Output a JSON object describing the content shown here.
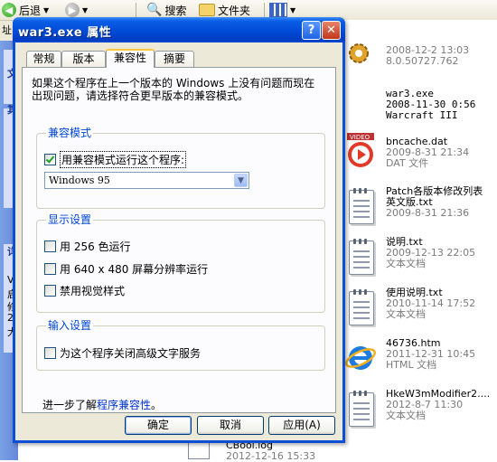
{
  "explorer": {
    "toolbar": {
      "back_label": "后退",
      "search_label": "搜索",
      "folders_label": "文件夹"
    },
    "address_label": "址",
    "left_pane_fragments": [
      "文",
      "其",
      "详",
      "V",
      "启",
      "修",
      "20",
      "大"
    ],
    "files": [
      {
        "name": "",
        "line2": "2008-12-2 13:03",
        "line3": "8.0.50727.762",
        "icon": "gear-icon",
        "mono": false
      },
      {
        "name": "war3.exe",
        "line2": "2008-11-30 0:56",
        "line3": "Warcraft III",
        "icon": "app-icon",
        "mono": true
      },
      {
        "name": "bncache.dat",
        "line2": "2009-8-31 21:34",
        "line3": "DAT 文件",
        "icon": "video-icon",
        "mono": false
      },
      {
        "name": "Patch各版本修改列表",
        "name2": "英文版.txt",
        "line2": "2009-8-31 21:36",
        "line3": "",
        "icon": "text-document-icon",
        "mono": false
      },
      {
        "name": "说明.txt",
        "line2": "2009-12-13 22:05",
        "line3": "文本文档",
        "icon": "text-document-icon",
        "mono": false
      },
      {
        "name": "使用说明.txt",
        "line2": "2010-11-14 17:52",
        "line3": "文本文档",
        "icon": "text-document-icon",
        "mono": false
      },
      {
        "name": "46736.htm",
        "line2": "2011-12-31 10:45",
        "line3": "HTML 文档",
        "icon": "internet-explorer-icon",
        "mono": false
      },
      {
        "name": "HkeW3mModifier2....",
        "line2": "2012-8-7 11:30",
        "line3": "文本文档",
        "icon": "text-document-icon",
        "mono": false
      },
      {
        "name": "CBool.log",
        "line2": "2012-12-16 15:33",
        "line3": "",
        "icon": "log-icon",
        "mono": false
      }
    ]
  },
  "dialog": {
    "title": "war3.exe 属性",
    "help_glyph": "?",
    "close_glyph": "✕",
    "tabs": [
      "常规",
      "版本",
      "兼容性",
      "摘要"
    ],
    "active_tab": "兼容性",
    "intro": "如果这个程序在上一个版本的 Windows 上没有问题而现在出现问题，请选择符合更早版本的兼容模式。",
    "compat_group": {
      "label": "兼容模式",
      "checkbox_label": "用兼容模式运行这个程序:",
      "checked": true,
      "select_value": "Windows 95"
    },
    "display_group": {
      "label": "显示设置",
      "options": [
        {
          "label": "用 256 色运行",
          "checked": false
        },
        {
          "label": "用 640 x 480 屏幕分辨率运行",
          "checked": false
        },
        {
          "label": "禁用视觉样式",
          "checked": false
        }
      ]
    },
    "input_group": {
      "label": "输入设置",
      "options": [
        {
          "label": "为这个程序关闭高级文字服务",
          "checked": false
        }
      ]
    },
    "more_prefix": "进一步了解",
    "more_link": "程序兼容性",
    "more_suffix": "。",
    "buttons": {
      "ok": "确定",
      "cancel": "取消",
      "apply": "应用(A)"
    }
  }
}
